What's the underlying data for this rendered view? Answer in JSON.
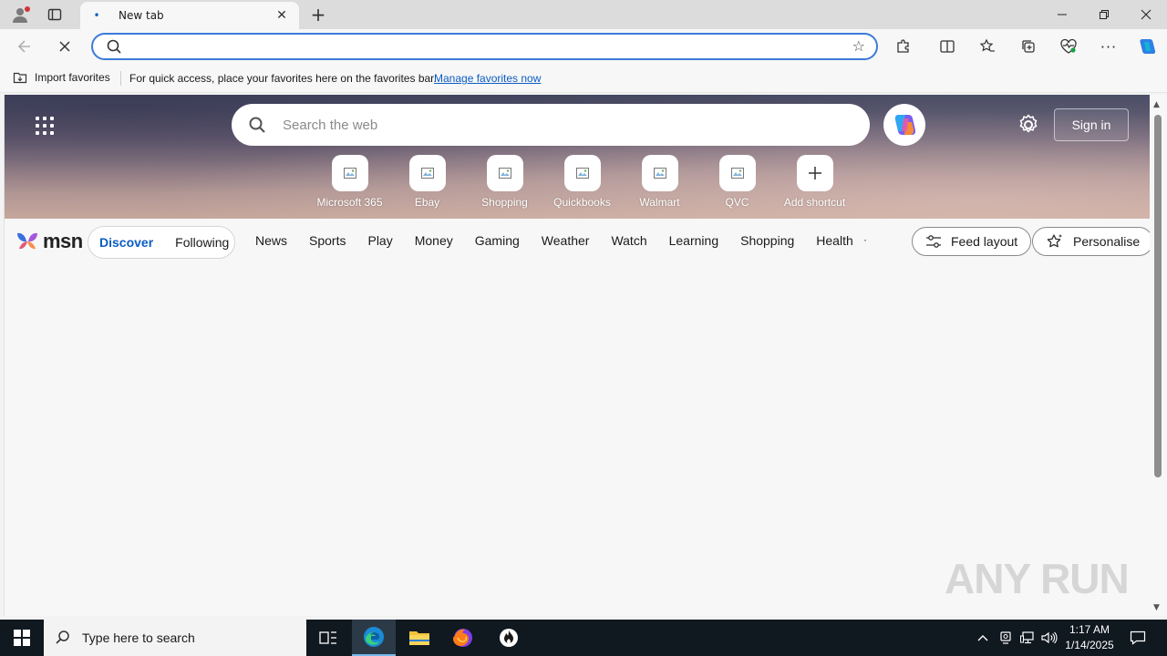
{
  "browser": {
    "tab_title": "New tab",
    "address_value": "",
    "favorites_bar": {
      "import_label": "Import favorites",
      "message": "For quick access, place your favorites here on the favorites bar.",
      "manage_link": "Manage favorites now"
    }
  },
  "msn": {
    "search_placeholder": "Search the web",
    "sign_in": "Sign in",
    "logo_text": "msn",
    "shortcuts": [
      {
        "label": "Microsoft 365"
      },
      {
        "label": "Ebay"
      },
      {
        "label": "Shopping"
      },
      {
        "label": "Quickbooks"
      },
      {
        "label": "Walmart"
      },
      {
        "label": "QVC"
      },
      {
        "label": "Add shortcut"
      }
    ],
    "tabs": {
      "discover": "Discover",
      "following": "Following"
    },
    "categories": [
      "News",
      "Sports",
      "Play",
      "Money",
      "Gaming",
      "Weather",
      "Watch",
      "Learning",
      "Shopping",
      "Health"
    ],
    "feed_layout": "Feed layout",
    "personalise": "Personalise"
  },
  "watermark": {
    "text": "ANY RUN"
  },
  "taskbar": {
    "search_placeholder": "Type here to search",
    "time": "1:17 AM",
    "date": "1/14/2025"
  },
  "colors": {
    "accent_blue": "#0b5cc2",
    "address_border": "#3c7bd8",
    "taskbar_bg": "#101820"
  }
}
